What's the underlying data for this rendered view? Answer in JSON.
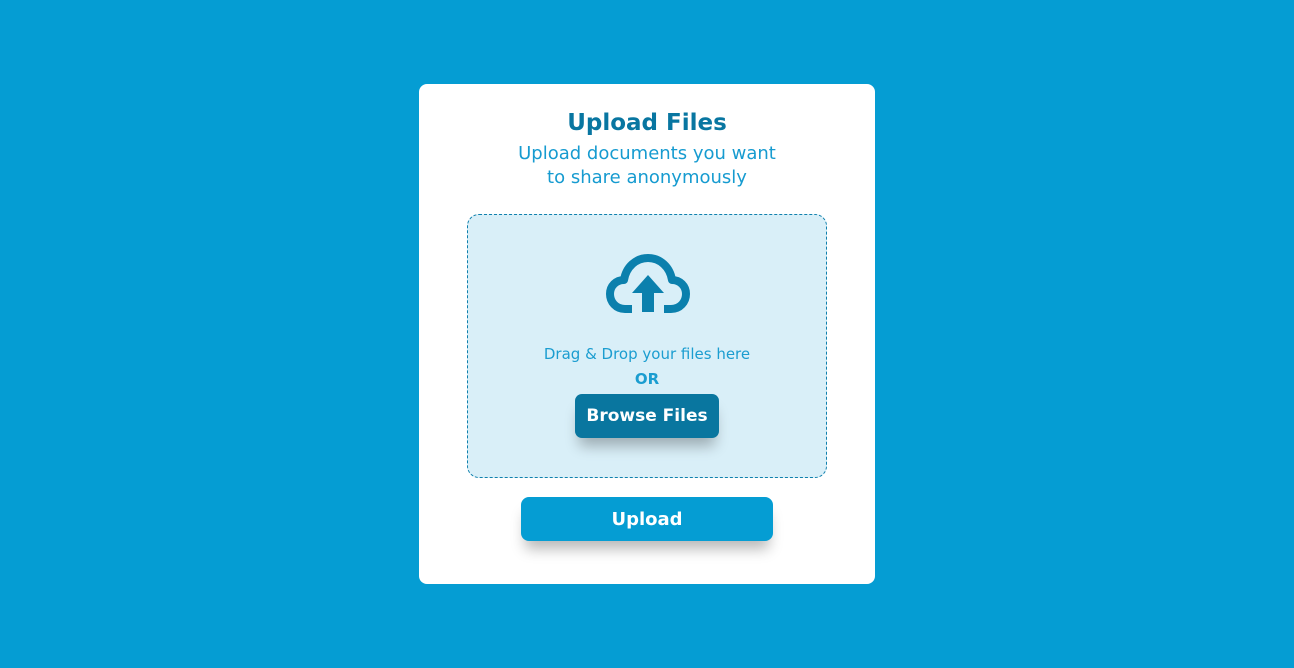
{
  "card": {
    "title": "Upload Files",
    "subtitle_line1": "Upload documents you want",
    "subtitle_line2": "to share anonymously"
  },
  "dropzone": {
    "icon": "cloud-upload-icon",
    "drag_text": "Drag & Drop your files here",
    "or_text": "OR",
    "browse_label": "Browse Files"
  },
  "actions": {
    "upload_label": "Upload"
  },
  "colors": {
    "background": "#059dd3",
    "primary_dark": "#09769f",
    "accent": "#1b9dd0",
    "dropzone_bg": "#d9eff8"
  }
}
